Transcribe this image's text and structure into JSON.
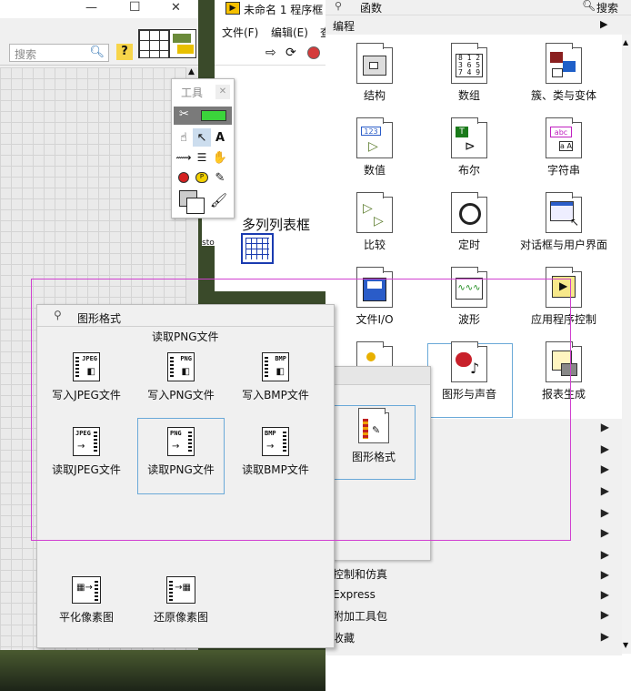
{
  "left_window": {
    "search_placeholder": "搜索",
    "minimize": "—",
    "maximize": "☐",
    "close": "✕"
  },
  "tools_palette": {
    "title": "工具"
  },
  "block_diagram": {
    "title": "未命名 1 程序框",
    "menu_file": "文件(F)",
    "menu_edit": "编辑(E)",
    "menu_more": "查",
    "node_label": "多列列表框",
    "node_sub": "sto"
  },
  "functions_palette": {
    "title": "函数",
    "search_label": "搜索",
    "category": "编程",
    "items": [
      {
        "label": "结构"
      },
      {
        "label": "数组"
      },
      {
        "label": "簇、类与变体"
      },
      {
        "label": "数值"
      },
      {
        "label": "布尔"
      },
      {
        "label": "字符串"
      },
      {
        "label": "比较"
      },
      {
        "label": "定时"
      },
      {
        "label": "对话框与用户界面"
      },
      {
        "label": "文件I/O"
      },
      {
        "label": "波形"
      },
      {
        "label": "应用程序控制"
      },
      {
        "label": "图形与声音"
      },
      {
        "label": "报表生成"
      }
    ],
    "rows": [
      {
        "label": "控制和仿真"
      },
      {
        "label": "Express"
      },
      {
        "label": "附加工具包"
      },
      {
        "label": "收藏"
      }
    ]
  },
  "graphics_subpalette": {
    "item_label": "图形格式"
  },
  "graphics_formats": {
    "title": "图形格式",
    "hover_label": "读取PNG文件",
    "items": [
      {
        "label": "写入JPEG文件",
        "tag": "JPEG"
      },
      {
        "label": "写入PNG文件",
        "tag": "PNG"
      },
      {
        "label": "写入BMP文件",
        "tag": "BMP"
      },
      {
        "label": "读取JPEG文件",
        "tag": "JPEG"
      },
      {
        "label": "读取PNG文件",
        "tag": "PNG"
      },
      {
        "label": "读取BMP文件",
        "tag": "BMP"
      },
      {
        "label": "平化像素图",
        "tag": ""
      },
      {
        "label": "还原像素图",
        "tag": ""
      }
    ]
  }
}
